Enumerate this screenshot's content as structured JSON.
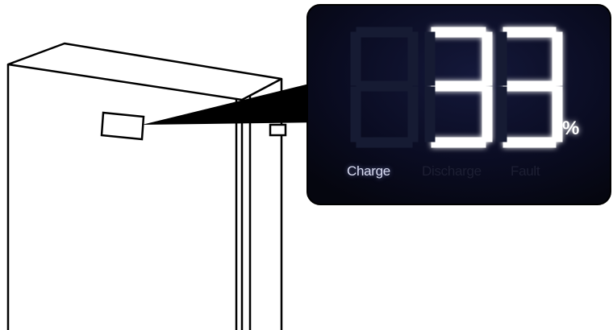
{
  "display": {
    "value": "33",
    "unit": "%",
    "active_segment_color": "#ffffff",
    "glow_color": "#b8c0ff",
    "inactive_segment_color": "#151a2e",
    "screen_color": "#07091a",
    "status_labels": [
      {
        "label": "Charge",
        "active": true
      },
      {
        "label": "Discharge",
        "active": false
      },
      {
        "label": "Fault",
        "active": false
      }
    ]
  },
  "diagram": {
    "line_color": "#000000",
    "callout_color": "#000000"
  }
}
